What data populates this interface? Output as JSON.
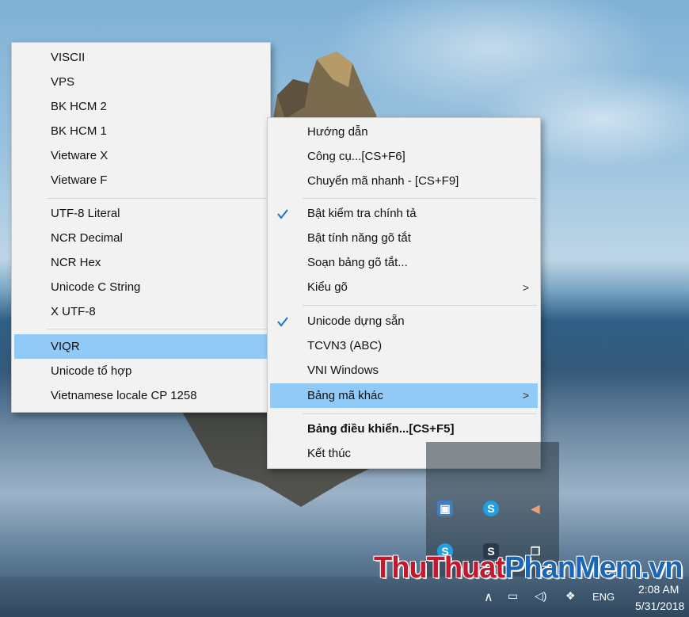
{
  "left_menu": {
    "items": [
      {
        "label": "VISCII"
      },
      {
        "label": "VPS"
      },
      {
        "label": "BK HCM 2"
      },
      {
        "label": "BK HCM 1"
      },
      {
        "label": "Vietware X"
      },
      {
        "label": "Vietware F"
      },
      {
        "label": "UTF-8 Literal"
      },
      {
        "label": "NCR Decimal"
      },
      {
        "label": "NCR Hex"
      },
      {
        "label": "Unicode C String"
      },
      {
        "label": "X UTF-8"
      },
      {
        "label": "VIQR",
        "highlighted": true
      },
      {
        "label": "Unicode tổ hợp"
      },
      {
        "label": "Vietnamese locale CP 1258"
      }
    ]
  },
  "right_menu": {
    "items": [
      {
        "label": "Hướng dẫn"
      },
      {
        "label": "Công cụ...[CS+F6]"
      },
      {
        "label": "Chuyển mã nhanh - [CS+F9]"
      },
      {
        "label": "Bật kiểm tra chính tả",
        "checked": true
      },
      {
        "label": "Bật tính năng gõ tắt"
      },
      {
        "label": "Soạn bảng gõ tắt..."
      },
      {
        "label": "Kiểu gõ",
        "submenu_arrow": ">"
      },
      {
        "label": "Unicode dựng sẵn",
        "checked": true
      },
      {
        "label": "TCVN3 (ABC)"
      },
      {
        "label": "VNI Windows"
      },
      {
        "label": "Bảng mã khác",
        "submenu_arrow": ">",
        "highlighted": true
      },
      {
        "label": "Bảng điều khiển...[CS+F5]",
        "bold": true
      },
      {
        "label": "Kết thúc"
      }
    ]
  },
  "taskbar": {
    "language": "ENG",
    "time": "2:08 AM",
    "date": "5/31/2018",
    "tray_icons": [
      "network-icon",
      "volume-icon",
      "dropbox-icon",
      "show-hidden-icons-chevron"
    ]
  },
  "tray_overflow": {
    "icons": [
      "app-icon",
      "skype-icon",
      "speaker-icon",
      "skype-icon",
      "s-app-icon",
      "copy-icon"
    ]
  },
  "watermark": {
    "part1": "ThuThuat",
    "part2": "PhanMem.vn"
  },
  "colors": {
    "highlight": "#91c9f7",
    "check": "#1a73c9",
    "menu_bg": "#f2f2f2",
    "arrow": "#e8524a"
  }
}
